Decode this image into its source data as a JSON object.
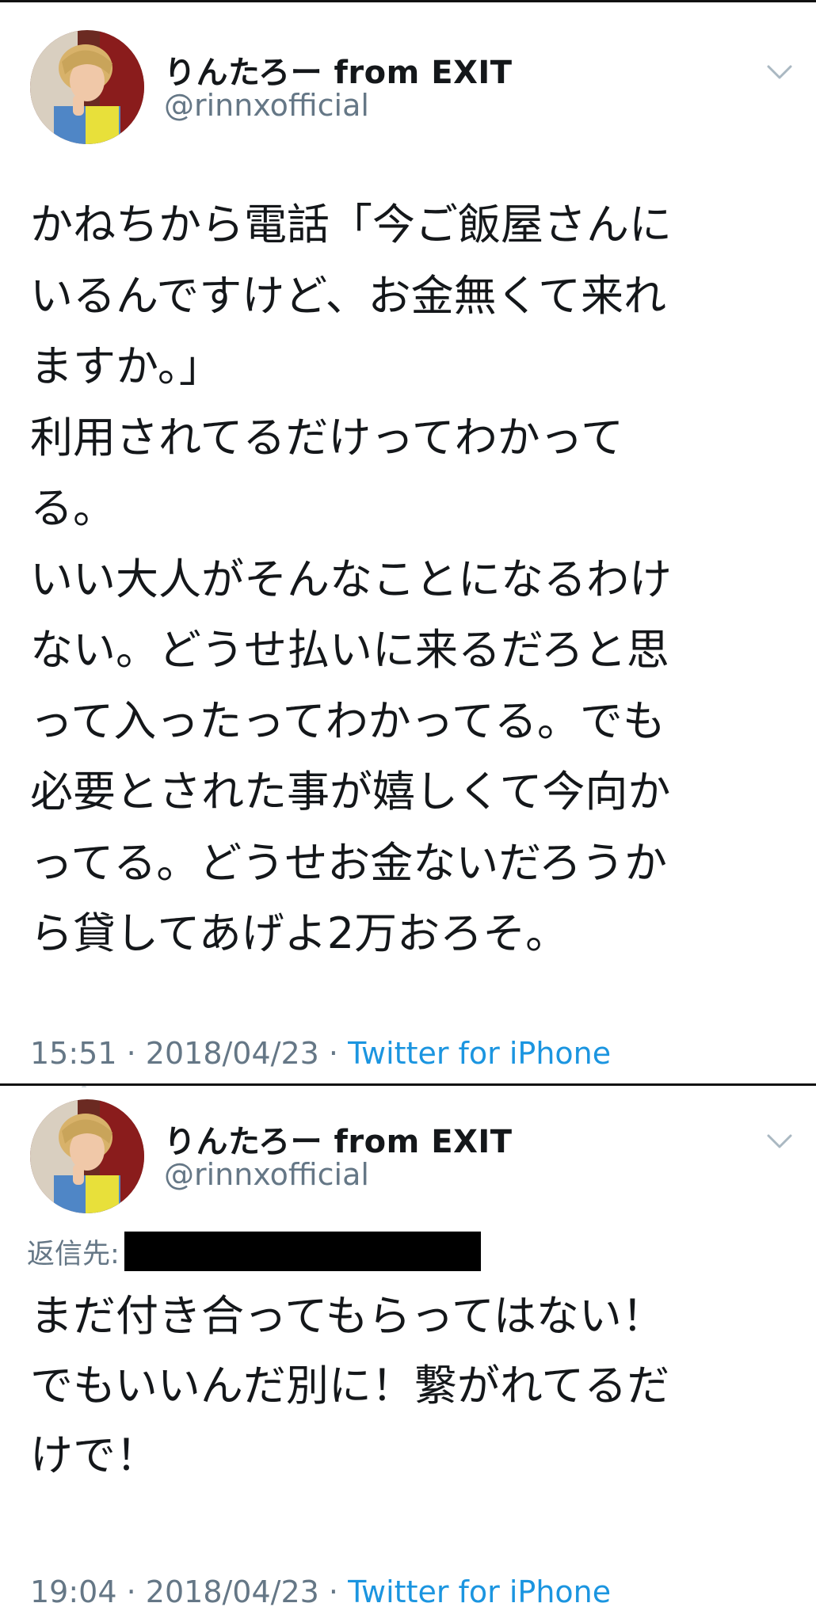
{
  "tweets": [
    {
      "user": {
        "display_name": "りんたろー from EXIT",
        "handle": "@rinnxofficial",
        "avatar_icon": "user-avatar-photo"
      },
      "text": "かねちから電話「今ご飯屋さんに\nいるんですけど、お金無くて来れ\nますか。」\n利用されてるだけってわかって\nる。\nいい大人がそんなことになるわけ\nない。どうせ払いに来るだろと思\nって入ったってわかってる。でも\n必要とされた事が嬉しくて今向か\nってる。どうせお金ないだろうか\nら貸してあげよ2万おろそ。",
      "time": "15:51",
      "date": "2018/04/23",
      "separator": "·",
      "source": "Twitter for iPhone",
      "menu_icon": "chevron-down-icon"
    },
    {
      "user": {
        "display_name": "りんたろー from EXIT",
        "handle": "@rinnxofficial",
        "avatar_icon": "user-avatar-photo"
      },
      "reply_label": "返信先:",
      "text": "まだ付き合ってもらってはない！\nでもいいんだ別に！繋がれてるだ\nけで！",
      "time": "19:04",
      "date": "2018/04/23",
      "separator": "·",
      "source": "Twitter for iPhone",
      "menu_icon": "chevron-down-icon"
    }
  ],
  "colors": {
    "text_primary": "#14171a",
    "text_secondary": "#657786",
    "link": "#1b95e0",
    "divider": "#111111"
  }
}
